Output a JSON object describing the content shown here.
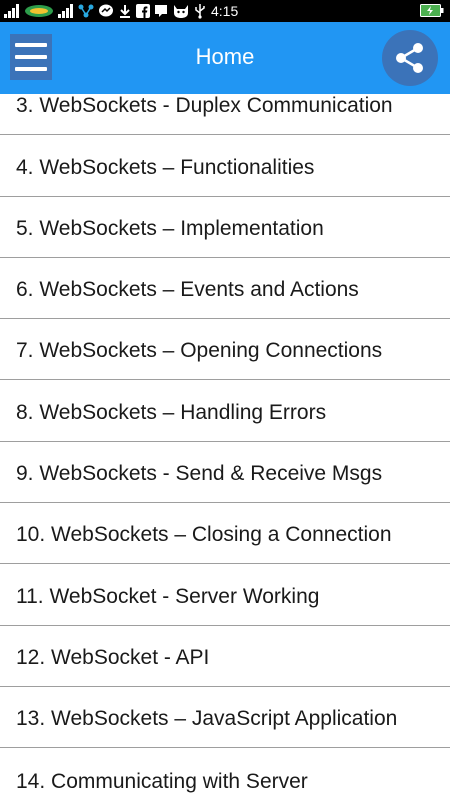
{
  "status_bar": {
    "time": "4:15",
    "icons": [
      "signal-icon",
      "carrier-logo-icon",
      "signal-icon",
      "network-share-icon",
      "messenger-icon",
      "download-icon",
      "facebook-icon",
      "hangouts-icon",
      "cat-icon",
      "usb-icon"
    ],
    "battery_icon": "battery-charging-icon"
  },
  "app_bar": {
    "title": "Home",
    "menu_icon": "hamburger-menu-icon",
    "share_icon": "share-icon",
    "color": "#2196F3",
    "button_color": "#3b73b9"
  },
  "list": {
    "items": [
      {
        "label": "3. WebSockets - Duplex Communication"
      },
      {
        "label": "4. WebSockets – Functionalities"
      },
      {
        "label": "5. WebSockets – Implementation"
      },
      {
        "label": "6. WebSockets – Events and Actions"
      },
      {
        "label": "7. WebSockets – Opening Connections"
      },
      {
        "label": "8. WebSockets – Handling Errors"
      },
      {
        "label": "9. WebSockets - Send & Receive Msgs"
      },
      {
        "label": "10. WebSockets – Closing a Connection"
      },
      {
        "label": "11. WebSocket - Server Working"
      },
      {
        "label": "12. WebSocket - API"
      },
      {
        "label": "13. WebSockets – JavaScript Application"
      },
      {
        "label": "14. Communicating with Server"
      }
    ]
  }
}
